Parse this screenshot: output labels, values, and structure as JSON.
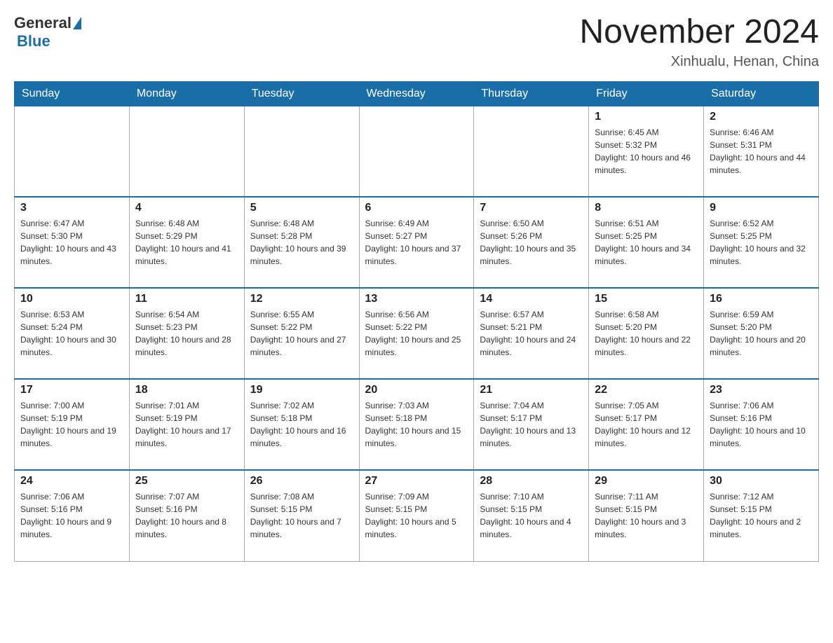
{
  "logo": {
    "general": "General",
    "blue": "Blue"
  },
  "title": "November 2024",
  "location": "Xinhualu, Henan, China",
  "weekdays": [
    "Sunday",
    "Monday",
    "Tuesday",
    "Wednesday",
    "Thursday",
    "Friday",
    "Saturday"
  ],
  "weeks": [
    [
      {
        "day": "",
        "info": ""
      },
      {
        "day": "",
        "info": ""
      },
      {
        "day": "",
        "info": ""
      },
      {
        "day": "",
        "info": ""
      },
      {
        "day": "",
        "info": ""
      },
      {
        "day": "1",
        "info": "Sunrise: 6:45 AM\nSunset: 5:32 PM\nDaylight: 10 hours and 46 minutes."
      },
      {
        "day": "2",
        "info": "Sunrise: 6:46 AM\nSunset: 5:31 PM\nDaylight: 10 hours and 44 minutes."
      }
    ],
    [
      {
        "day": "3",
        "info": "Sunrise: 6:47 AM\nSunset: 5:30 PM\nDaylight: 10 hours and 43 minutes."
      },
      {
        "day": "4",
        "info": "Sunrise: 6:48 AM\nSunset: 5:29 PM\nDaylight: 10 hours and 41 minutes."
      },
      {
        "day": "5",
        "info": "Sunrise: 6:48 AM\nSunset: 5:28 PM\nDaylight: 10 hours and 39 minutes."
      },
      {
        "day": "6",
        "info": "Sunrise: 6:49 AM\nSunset: 5:27 PM\nDaylight: 10 hours and 37 minutes."
      },
      {
        "day": "7",
        "info": "Sunrise: 6:50 AM\nSunset: 5:26 PM\nDaylight: 10 hours and 35 minutes."
      },
      {
        "day": "8",
        "info": "Sunrise: 6:51 AM\nSunset: 5:25 PM\nDaylight: 10 hours and 34 minutes."
      },
      {
        "day": "9",
        "info": "Sunrise: 6:52 AM\nSunset: 5:25 PM\nDaylight: 10 hours and 32 minutes."
      }
    ],
    [
      {
        "day": "10",
        "info": "Sunrise: 6:53 AM\nSunset: 5:24 PM\nDaylight: 10 hours and 30 minutes."
      },
      {
        "day": "11",
        "info": "Sunrise: 6:54 AM\nSunset: 5:23 PM\nDaylight: 10 hours and 28 minutes."
      },
      {
        "day": "12",
        "info": "Sunrise: 6:55 AM\nSunset: 5:22 PM\nDaylight: 10 hours and 27 minutes."
      },
      {
        "day": "13",
        "info": "Sunrise: 6:56 AM\nSunset: 5:22 PM\nDaylight: 10 hours and 25 minutes."
      },
      {
        "day": "14",
        "info": "Sunrise: 6:57 AM\nSunset: 5:21 PM\nDaylight: 10 hours and 24 minutes."
      },
      {
        "day": "15",
        "info": "Sunrise: 6:58 AM\nSunset: 5:20 PM\nDaylight: 10 hours and 22 minutes."
      },
      {
        "day": "16",
        "info": "Sunrise: 6:59 AM\nSunset: 5:20 PM\nDaylight: 10 hours and 20 minutes."
      }
    ],
    [
      {
        "day": "17",
        "info": "Sunrise: 7:00 AM\nSunset: 5:19 PM\nDaylight: 10 hours and 19 minutes."
      },
      {
        "day": "18",
        "info": "Sunrise: 7:01 AM\nSunset: 5:19 PM\nDaylight: 10 hours and 17 minutes."
      },
      {
        "day": "19",
        "info": "Sunrise: 7:02 AM\nSunset: 5:18 PM\nDaylight: 10 hours and 16 minutes."
      },
      {
        "day": "20",
        "info": "Sunrise: 7:03 AM\nSunset: 5:18 PM\nDaylight: 10 hours and 15 minutes."
      },
      {
        "day": "21",
        "info": "Sunrise: 7:04 AM\nSunset: 5:17 PM\nDaylight: 10 hours and 13 minutes."
      },
      {
        "day": "22",
        "info": "Sunrise: 7:05 AM\nSunset: 5:17 PM\nDaylight: 10 hours and 12 minutes."
      },
      {
        "day": "23",
        "info": "Sunrise: 7:06 AM\nSunset: 5:16 PM\nDaylight: 10 hours and 10 minutes."
      }
    ],
    [
      {
        "day": "24",
        "info": "Sunrise: 7:06 AM\nSunset: 5:16 PM\nDaylight: 10 hours and 9 minutes."
      },
      {
        "day": "25",
        "info": "Sunrise: 7:07 AM\nSunset: 5:16 PM\nDaylight: 10 hours and 8 minutes."
      },
      {
        "day": "26",
        "info": "Sunrise: 7:08 AM\nSunset: 5:15 PM\nDaylight: 10 hours and 7 minutes."
      },
      {
        "day": "27",
        "info": "Sunrise: 7:09 AM\nSunset: 5:15 PM\nDaylight: 10 hours and 5 minutes."
      },
      {
        "day": "28",
        "info": "Sunrise: 7:10 AM\nSunset: 5:15 PM\nDaylight: 10 hours and 4 minutes."
      },
      {
        "day": "29",
        "info": "Sunrise: 7:11 AM\nSunset: 5:15 PM\nDaylight: 10 hours and 3 minutes."
      },
      {
        "day": "30",
        "info": "Sunrise: 7:12 AM\nSunset: 5:15 PM\nDaylight: 10 hours and 2 minutes."
      }
    ]
  ]
}
